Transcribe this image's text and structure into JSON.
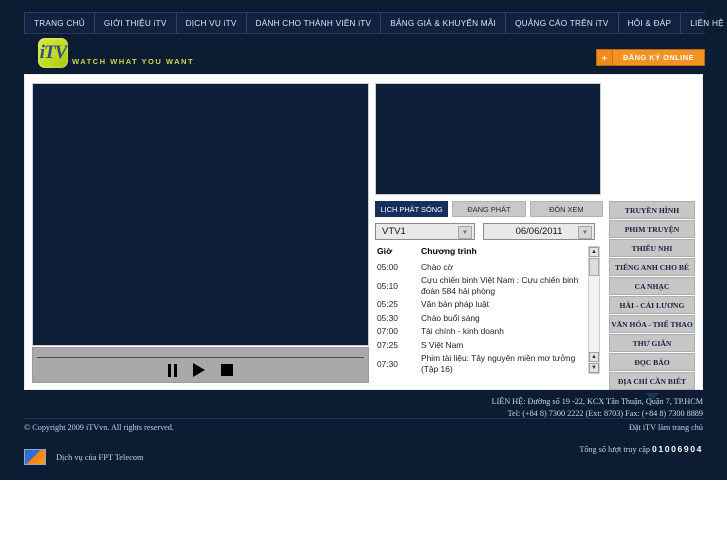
{
  "nav": {
    "items": [
      {
        "label": "TRANG CHỦ"
      },
      {
        "label": "GIỚI THIỆU iTV"
      },
      {
        "label": "DỊCH VỤ iTV"
      },
      {
        "label": "DÀNH CHO THÀNH VIÊN iTV"
      },
      {
        "label": "BẢNG GIÁ & KHUYẾN MÃI"
      },
      {
        "label": "QUẢNG CÁO TRÊN iTV"
      },
      {
        "label": "HỎI & ĐÁP"
      },
      {
        "label": "LIÊN HỆ"
      }
    ]
  },
  "brand": {
    "logo_text": "iTV",
    "tagline": "WATCH WHAT YOU WANT",
    "register_plus": "+",
    "register_label": "ĐĂNG KÝ ONLINE",
    "accent_color": "#f59322",
    "logo_color": "#c3dc1e",
    "page_bg": "#0b1c33"
  },
  "player": {
    "pause_label": "",
    "play_label": "",
    "stop_label": ""
  },
  "tabs": [
    {
      "label": "LỊCH PHÁT SÓNG",
      "active": true
    },
    {
      "label": "ĐANG PHÁT",
      "active": false
    },
    {
      "label": "ĐÓN XEM",
      "active": false
    }
  ],
  "selectors": {
    "channel": "VTV1",
    "date": "06/06/2011",
    "arrow_glyph": "▼"
  },
  "schedule": {
    "headers": {
      "time": "Giờ",
      "program": "Chương trình"
    },
    "rows": [
      {
        "time": "05:00",
        "program": "Chào cờ"
      },
      {
        "time": "05:10",
        "program": "Cựu chiến binh Việt Nam : Cựu chiến binh đoàn 584 hải phòng"
      },
      {
        "time": "05:25",
        "program": "Văn bản pháp luật"
      },
      {
        "time": "05:30",
        "program": "Chào buổi sáng"
      },
      {
        "time": "07:00",
        "program": "Tài chính - kinh doanh"
      },
      {
        "time": "07:25",
        "program": "S Việt Nam"
      },
      {
        "time": "07:30",
        "program": "Phim tài liệu: Tây nguyên miền mơ tưởng (Tập 16)"
      }
    ],
    "scroll": {
      "up_glyph": "▲",
      "down_glyph": "▼"
    }
  },
  "categories": [
    {
      "label": "TRUYỀN HÌNH"
    },
    {
      "label": "PHIM TRUYỆN"
    },
    {
      "label": "THIẾU NHI"
    },
    {
      "label": "TIẾNG ANH CHO BÉ"
    },
    {
      "label": "CA NHẠC"
    },
    {
      "label": "HÀI - CẢI LƯƠNG"
    },
    {
      "label": "VĂN HÓA - THỂ THAO"
    },
    {
      "label": "THƯ GIÃN"
    },
    {
      "label": "ĐỌC BÁO"
    },
    {
      "label": "ĐỊA CHỈ CẦN BIẾT"
    }
  ],
  "footer": {
    "contact_line1": "LIÊN HỆ: Đường số 19 -22, KCX Tân Thuận, Quận 7, TP.HCM",
    "contact_line2": "Tel: (+84 8) 7300 2222 (Ext: 8703)     Fax: (+84 8) 7300 8889",
    "copyright": "© Copyright 2009 iTVvn. All rights reserved.",
    "set_homepage": "Đặt iTV làm trang chủ",
    "fpt_text": "Dịch vụ của FPT Telecom",
    "counter_label": "Tổng số lượt truy cập",
    "counter_value": "01006904"
  }
}
